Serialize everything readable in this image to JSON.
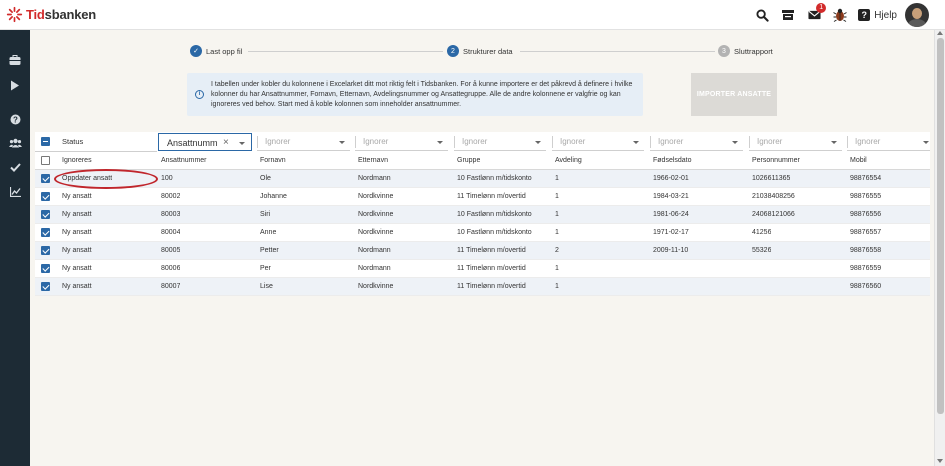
{
  "app": {
    "logo_prefix": "Tid",
    "logo_suffix": "sbanken",
    "help_label": "Hjelp",
    "mail_badge": "1"
  },
  "stepper": {
    "steps": [
      {
        "label": "Last opp fil",
        "state": "done",
        "marker": "✓"
      },
      {
        "label": "Strukturer data",
        "state": "active",
        "marker": "2"
      },
      {
        "label": "Sluttrapport",
        "state": "pending",
        "marker": "3"
      }
    ]
  },
  "info": {
    "text": "I tabellen under kobler du kolonnene i Excelarket ditt mot riktig felt i Tidsbanken. For å kunne importere er det påkrevd å definere i hvilke kolonner du har Ansattnummer, Fornavn, Etternavn, Avdelingsnummer og Ansattegruppe. Alle de andre kolonnene er valgfrie og kan ignoreres ved behov. Start med å koble kolonnen som inneholder ansattnummer."
  },
  "import_button": {
    "label": "IMPORTER ANSATTE"
  },
  "table": {
    "status_header": "Status",
    "selectors": [
      {
        "value": "Ansattnumm",
        "placeholder": "",
        "active": true
      },
      {
        "value": "",
        "placeholder": "Ignorer"
      },
      {
        "value": "",
        "placeholder": "Ignorer"
      },
      {
        "value": "",
        "placeholder": "Ignorer"
      },
      {
        "value": "",
        "placeholder": "Ignorer"
      },
      {
        "value": "",
        "placeholder": "Ignorer"
      },
      {
        "value": "",
        "placeholder": "Ignorer"
      },
      {
        "value": "",
        "placeholder": "Ignorer"
      }
    ],
    "headers": [
      "Ignoreres",
      "Ansattnummer",
      "Fornavn",
      "Etternavn",
      "Gruppe",
      "Avdeling",
      "Fødselsdato",
      "Personnummer",
      "Mobil"
    ],
    "rows": [
      [
        "Oppdater ansatt",
        "100",
        "Ole",
        "Nordmann",
        "10 Fastlønn m/tidskonto",
        "1",
        "1966-02-01",
        "1026611365",
        "98876554"
      ],
      [
        "Ny ansatt",
        "80002",
        "Johanne",
        "Nordkvinne",
        "11 Timelønn m/overtid",
        "1",
        "1984-03-21",
        "21038408256",
        "98876555"
      ],
      [
        "Ny ansatt",
        "80003",
        "Siri",
        "Nordkvinne",
        "10 Fastlønn m/tidskonto",
        "1",
        "1981-06-24",
        "24068121066",
        "98876556"
      ],
      [
        "Ny ansatt",
        "80004",
        "Anne",
        "Nordkvinne",
        "10 Fastlønn m/tidskonto",
        "1",
        "1971-02-17",
        "41256",
        "98876557"
      ],
      [
        "Ny ansatt",
        "80005",
        "Petter",
        "Nordmann",
        "11 Timelønn m/overtid",
        "2",
        "2009-11-10",
        "55326",
        "98876558"
      ],
      [
        "Ny ansatt",
        "80006",
        "Per",
        "Nordmann",
        "11 Timelønn m/overtid",
        "1",
        "",
        "",
        "98876559"
      ],
      [
        "Ny ansatt",
        "80007",
        "Lise",
        "Nordkvinne",
        "11 Timelønn m/overtid",
        "1",
        "",
        "",
        "98876560"
      ]
    ]
  },
  "colors": {
    "primary": "#2b68a6",
    "sidebar": "#1d2b35",
    "highlight": "#c0262c",
    "logo_red": "#d22b2b"
  }
}
